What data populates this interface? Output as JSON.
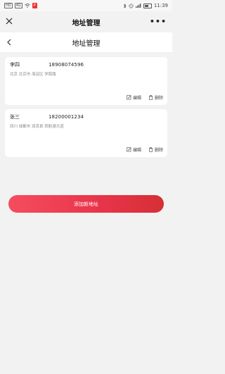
{
  "status_bar": {
    "left_chips": [
      "HD",
      "4G"
    ],
    "app_badge": "P",
    "time": "11:39"
  },
  "mini_program_header": {
    "title": "地址管理",
    "more": "•••"
  },
  "nav": {
    "title": "地址管理"
  },
  "addresses": [
    {
      "name": "李四",
      "phone": "18908074596",
      "detail": "北京 北京市 海淀区  学院路",
      "edit_label": "编辑",
      "delete_label": "删除"
    },
    {
      "name": "张三",
      "phone": "18200001234",
      "detail": "四川 成都市 双流县  西航港大道",
      "edit_label": "编辑",
      "delete_label": "删除"
    }
  ],
  "add_button": {
    "label": "添加新地址"
  },
  "colors": {
    "accent_start": "#f54d5e",
    "accent_end": "#d62f36",
    "background": "#f2f2f2"
  }
}
